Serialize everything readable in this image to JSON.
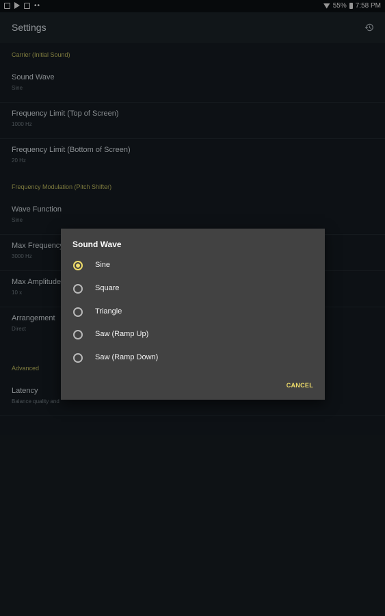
{
  "status_bar": {
    "battery": "55%",
    "time": "7:58 PM",
    "dots": "••"
  },
  "app_bar": {
    "title": "Settings",
    "action_icon": "restore-icon"
  },
  "sections": [
    {
      "header": "Carrier (Initial Sound)",
      "items": [
        {
          "title": "Sound Wave",
          "summary": "Sine"
        },
        {
          "title": "Frequency Limit (Top of Screen)",
          "summary": "1000 Hz"
        },
        {
          "title": "Frequency Limit (Bottom of Screen)",
          "summary": "20 Hz"
        }
      ]
    },
    {
      "header": "Frequency Modulation (Pitch Shifter)",
      "items": [
        {
          "title": "Wave Function",
          "summary": "Sine"
        },
        {
          "title": "Max Frequency",
          "summary": "3000 Hz"
        },
        {
          "title": "Max Amplitude",
          "summary": "10 x"
        },
        {
          "title": "Arrangement",
          "summary": "Direct"
        }
      ]
    },
    {
      "header": "Advanced",
      "items": [
        {
          "title": "Latency",
          "summary": "Balance quality and"
        }
      ]
    }
  ],
  "dialog": {
    "title": "Sound Wave",
    "options": [
      "Sine",
      "Square",
      "Triangle",
      "Saw (Ramp Up)",
      "Saw (Ramp Down)"
    ],
    "selected": "Sine",
    "cancel_label": "CANCEL"
  },
  "colors": {
    "accent": "#f0dd6a",
    "section_header": "#b7b35a",
    "background": "#141a1f",
    "dialog": "#424242"
  }
}
